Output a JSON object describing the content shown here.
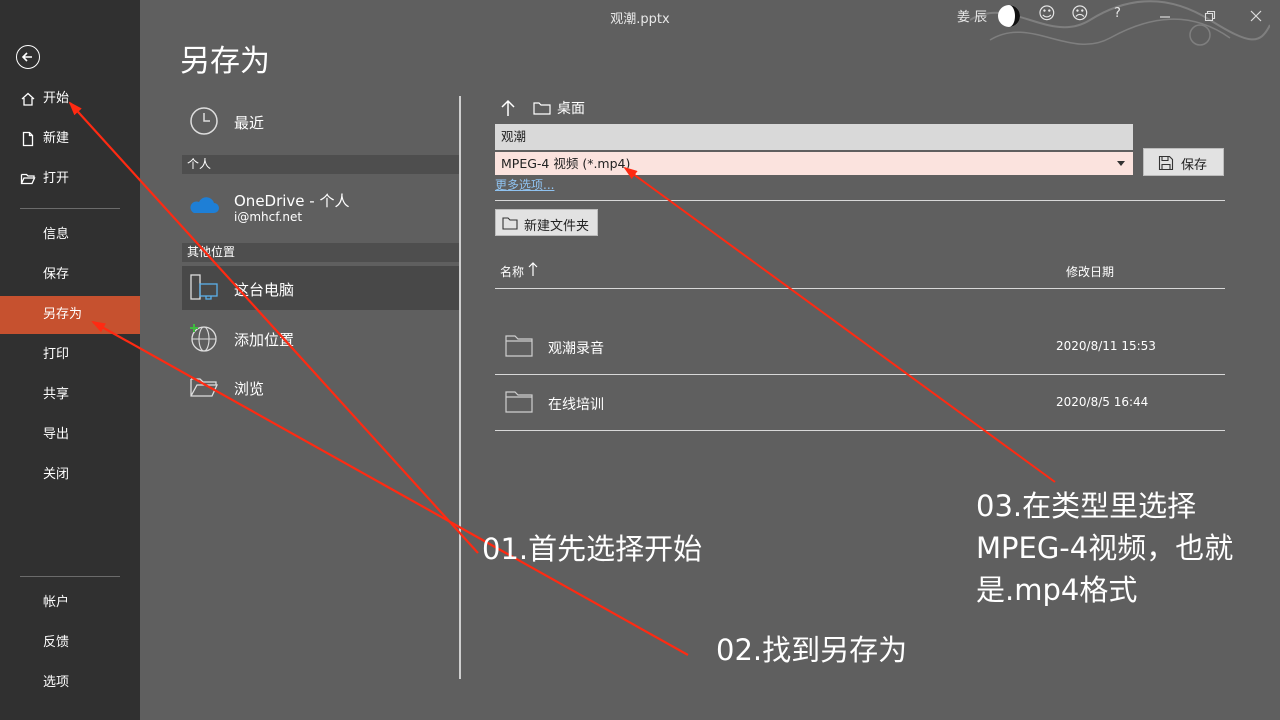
{
  "window": {
    "title": "观潮.pptx",
    "user": "姜 辰",
    "controls": [
      "☺",
      "☹",
      "?"
    ]
  },
  "sidebar": {
    "items": [
      {
        "label": "开始",
        "icon": "home-icon"
      },
      {
        "label": "新建",
        "icon": "new-file-icon"
      },
      {
        "label": "打开",
        "icon": "open-folder-icon"
      },
      {
        "label": "信息"
      },
      {
        "label": "保存"
      },
      {
        "label": "另存为",
        "active": true
      },
      {
        "label": "打印"
      },
      {
        "label": "共享"
      },
      {
        "label": "导出"
      },
      {
        "label": "关闭"
      },
      {
        "label": "帐户"
      },
      {
        "label": "反馈"
      },
      {
        "label": "选项"
      }
    ]
  },
  "page": {
    "title": "另存为"
  },
  "locations": {
    "recent": "最近",
    "section_personal": "个人",
    "onedrive": {
      "name": "OneDrive - 个人",
      "email": "i@mhcf.net"
    },
    "section_other": "其他位置",
    "this_pc": "这台电脑",
    "add_place": "添加位置",
    "browse": "浏览"
  },
  "save_panel": {
    "breadcrumb": "桌面",
    "filename": "观潮",
    "filetype": "MPEG-4 视频 (*.mp4)",
    "save_label": "保存",
    "more_options": "更多选项...",
    "new_folder": "新建文件夹",
    "col_name": "名称",
    "col_date": "修改日期",
    "files": [
      {
        "name": "观潮录音",
        "date": "2020/8/11 15:53"
      },
      {
        "name": "在线培训",
        "date": "2020/8/5 16:44"
      }
    ]
  },
  "annotations": {
    "step1": "01.首先选择开始",
    "step2": "02.找到另存为",
    "step3_line1": "03.在类型里选择",
    "step3_line2": "MPEG-4视频，也就",
    "step3_line3": "是.mp4格式"
  },
  "colors": {
    "sidebar_bg": "#303030",
    "main_bg": "#5f5f5f",
    "active": "#c6512f",
    "filetype_bg": "#fbe3de",
    "arrow": "#ff2a12"
  }
}
